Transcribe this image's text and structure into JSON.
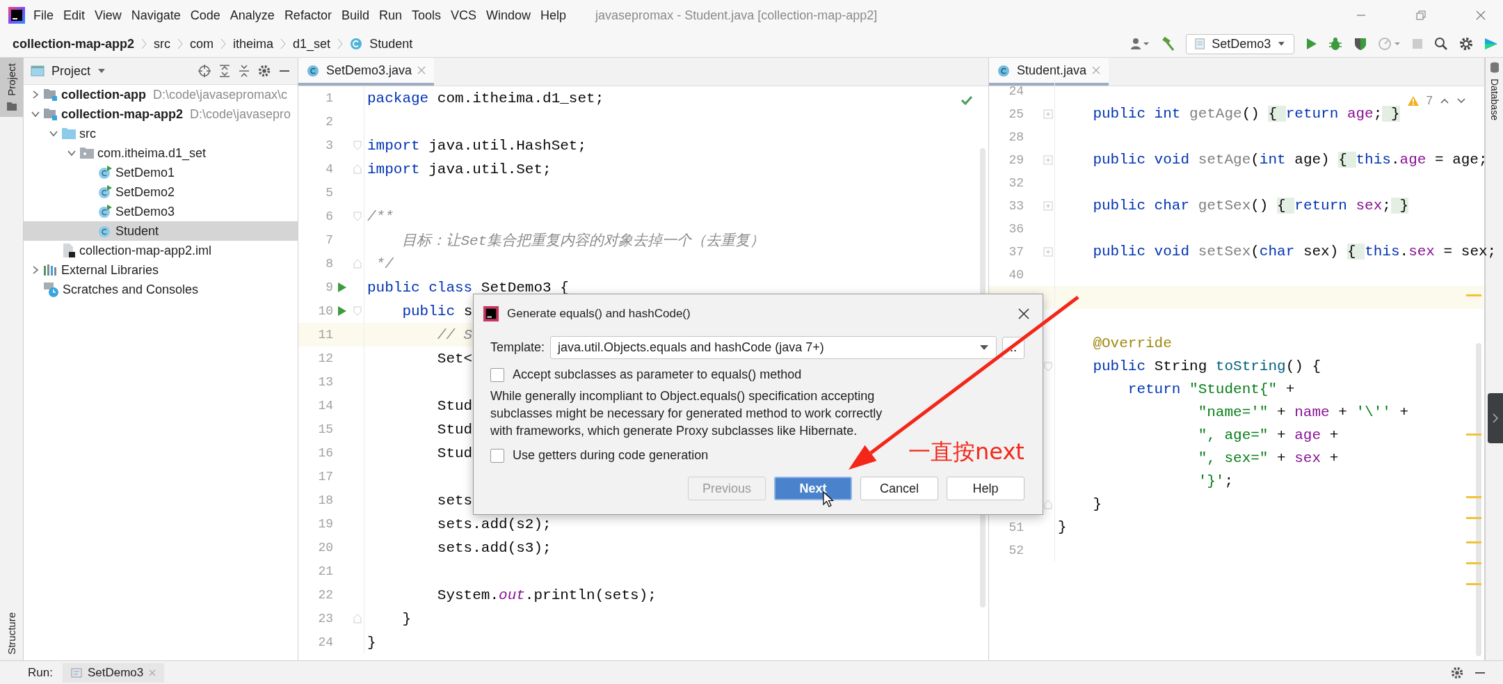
{
  "window": {
    "title": "javasepromax - Student.java [collection-map-app2]"
  },
  "menu": [
    "File",
    "Edit",
    "View",
    "Navigate",
    "Code",
    "Analyze",
    "Refactor",
    "Build",
    "Run",
    "Tools",
    "VCS",
    "Window",
    "Help"
  ],
  "breadcrumb": [
    {
      "label": "collection-map-app2",
      "kind": "project"
    },
    {
      "label": "src",
      "kind": "dir"
    },
    {
      "label": "com",
      "kind": "dir"
    },
    {
      "label": "itheima",
      "kind": "dir"
    },
    {
      "label": "d1_set",
      "kind": "dir"
    },
    {
      "label": "Student",
      "kind": "class"
    }
  ],
  "toolbar": {
    "run_config": "SetDemo3"
  },
  "left_stripe": {
    "top": [
      {
        "label": "Project",
        "selected": true
      }
    ],
    "bottom": [
      {
        "label": "Structure",
        "selected": false
      }
    ]
  },
  "right_stripe": [
    {
      "label": "Database",
      "selected": false
    }
  ],
  "project": {
    "title": "Project",
    "tree": [
      {
        "label": "collection-app",
        "path": "D:\\code\\javasepromax\\c",
        "kind": "module",
        "expanded": false,
        "selected": false
      },
      {
        "label": "collection-map-app2",
        "path": "D:\\code\\javasepro",
        "kind": "module",
        "expanded": true,
        "selected": false,
        "children": [
          {
            "label": "src",
            "kind": "source-folder",
            "expanded": true,
            "selected": false,
            "children": [
              {
                "label": "com.itheima.d1_set",
                "kind": "package",
                "expanded": true,
                "selected": false,
                "children": [
                  {
                    "label": "SetDemo1",
                    "kind": "runnable-class",
                    "selected": false
                  },
                  {
                    "label": "SetDemo2",
                    "kind": "runnable-class",
                    "selected": false
                  },
                  {
                    "label": "SetDemo3",
                    "kind": "runnable-class",
                    "selected": false
                  },
                  {
                    "label": "Student",
                    "kind": "class",
                    "selected": true
                  }
                ]
              }
            ]
          },
          {
            "label": "collection-map-app2.iml",
            "kind": "module-file",
            "selected": false
          }
        ]
      },
      {
        "label": "External Libraries",
        "kind": "libraries",
        "expanded": false,
        "selected": false
      },
      {
        "label": "Scratches and Consoles",
        "kind": "scratches",
        "selected": false
      }
    ]
  },
  "editors": [
    {
      "tabs": [
        {
          "label": "SetDemo3.java",
          "selected": true
        }
      ],
      "lines": [
        {
          "n": "1",
          "run": false,
          "current": false,
          "tokens": [
            {
              "kind": "kw",
              "text": "package"
            },
            {
              "kind": "plain",
              "text": " com.itheima.d1_set;"
            }
          ]
        },
        {
          "n": "2",
          "run": false,
          "current": false
        },
        {
          "n": "3",
          "run": false,
          "current": false,
          "fold": {
            "kind": "start"
          },
          "tokens": [
            {
              "kind": "kw",
              "text": "import"
            },
            {
              "kind": "plain",
              "text": " java.util.HashSet;"
            }
          ]
        },
        {
          "n": "4",
          "run": false,
          "current": false,
          "fold": {
            "kind": "end"
          },
          "tokens": [
            {
              "kind": "kw",
              "text": "import"
            },
            {
              "kind": "plain",
              "text": " java.util.Set;"
            }
          ]
        },
        {
          "n": "5",
          "run": false,
          "current": false
        },
        {
          "n": "6",
          "run": false,
          "current": false,
          "fold": {
            "kind": "start"
          },
          "tokens": [
            {
              "kind": "comment",
              "text": "/**"
            }
          ]
        },
        {
          "n": "7",
          "run": false,
          "current": false,
          "tokens": [
            {
              "kind": "comment",
              "text": "    目标：让Set集合把重复内容的对象去掉一个（去重复）"
            }
          ]
        },
        {
          "n": "8",
          "run": false,
          "current": false,
          "fold": {
            "kind": "end"
          },
          "tokens": [
            {
              "kind": "comment",
              "text": " */"
            }
          ]
        },
        {
          "n": "9",
          "run": true,
          "current": false,
          "tokens": [
            {
              "kind": "kw",
              "text": "public class"
            },
            {
              "kind": "plain",
              "text": " SetDemo3 {"
            }
          ]
        },
        {
          "n": "10",
          "run": true,
          "current": false,
          "fold": {
            "kind": "start"
          },
          "tokens": [
            {
              "kind": "kw",
              "text": "    public"
            },
            {
              "kind": "plain",
              "text": " s"
            }
          ]
        },
        {
          "n": "11",
          "run": false,
          "current": true,
          "tokens": [
            {
              "kind": "comment",
              "text": "        // S"
            }
          ]
        },
        {
          "n": "12",
          "run": false,
          "current": false,
          "tokens": [
            {
              "kind": "plain",
              "text": "        Set<"
            }
          ]
        },
        {
          "n": "13",
          "run": false,
          "current": false
        },
        {
          "n": "14",
          "run": false,
          "current": false,
          "tokens": [
            {
              "kind": "plain",
              "text": "        Stud"
            }
          ]
        },
        {
          "n": "15",
          "run": false,
          "current": false,
          "tokens": [
            {
              "kind": "plain",
              "text": "        Stud"
            }
          ]
        },
        {
          "n": "16",
          "run": false,
          "current": false,
          "tokens": [
            {
              "kind": "plain",
              "text": "        Stud"
            }
          ]
        },
        {
          "n": "17",
          "run": false,
          "current": false
        },
        {
          "n": "18",
          "run": false,
          "current": false,
          "tokens": [
            {
              "kind": "plain",
              "text": "        sets"
            }
          ]
        },
        {
          "n": "19",
          "run": false,
          "current": false,
          "tokens": [
            {
              "kind": "plain",
              "text": "        sets.add(s2);"
            }
          ]
        },
        {
          "n": "20",
          "run": false,
          "current": false,
          "tokens": [
            {
              "kind": "plain",
              "text": "        sets.add(s3);"
            }
          ]
        },
        {
          "n": "21",
          "run": false,
          "current": false
        },
        {
          "n": "22",
          "run": false,
          "current": false,
          "tokens": [
            {
              "kind": "plain",
              "text": "        System."
            },
            {
              "kind": "static",
              "text": "out"
            },
            {
              "kind": "plain",
              "text": ".println(sets);"
            }
          ]
        },
        {
          "n": "23",
          "run": false,
          "current": false,
          "fold": {
            "kind": "end"
          },
          "tokens": [
            {
              "kind": "plain",
              "text": "    }"
            }
          ]
        },
        {
          "n": "24",
          "run": false,
          "current": false,
          "tokens": [
            {
              "kind": "plain",
              "text": "}"
            }
          ]
        }
      ]
    },
    {
      "tabs": [
        {
          "label": "Student.java",
          "selected": true
        }
      ],
      "warnings": "7",
      "lines": [
        {
          "n": "24",
          "current": false
        },
        {
          "n": "25",
          "current": false,
          "fold": {
            "kind": "collapsed"
          },
          "tokens": [
            {
              "kind": "kw",
              "text": "    public int"
            },
            {
              "kind": "unused",
              "text": " getAge"
            },
            {
              "kind": "plain",
              "text": "() "
            },
            {
              "kind": "fold-brace",
              "text": "{ "
            },
            {
              "kind": "kw",
              "text": "return"
            },
            {
              "kind": "field",
              "text": " age"
            },
            {
              "kind": "plain",
              "text": ";"
            },
            {
              "kind": "fold-brace",
              "text": " }"
            }
          ]
        },
        {
          "n": "28",
          "current": false
        },
        {
          "n": "29",
          "current": false,
          "fold": {
            "kind": "collapsed"
          },
          "tokens": [
            {
              "kind": "kw",
              "text": "    public void"
            },
            {
              "kind": "unused",
              "text": " setAge"
            },
            {
              "kind": "plain",
              "text": "("
            },
            {
              "kind": "kw",
              "text": "int"
            },
            {
              "kind": "plain",
              "text": " age) "
            },
            {
              "kind": "fold-brace",
              "text": "{ "
            },
            {
              "kind": "kw",
              "text": "this"
            },
            {
              "kind": "plain",
              "text": "."
            },
            {
              "kind": "field",
              "text": "age"
            },
            {
              "kind": "plain",
              "text": " = age;"
            }
          ]
        },
        {
          "n": "32",
          "current": false
        },
        {
          "n": "33",
          "current": false,
          "fold": {
            "kind": "collapsed"
          },
          "tokens": [
            {
              "kind": "kw",
              "text": "    public char"
            },
            {
              "kind": "unused",
              "text": " getSex"
            },
            {
              "kind": "plain",
              "text": "() "
            },
            {
              "kind": "fold-brace",
              "text": "{ "
            },
            {
              "kind": "kw",
              "text": "return"
            },
            {
              "kind": "field",
              "text": " sex"
            },
            {
              "kind": "plain",
              "text": ";"
            },
            {
              "kind": "fold-brace",
              "text": " }"
            }
          ]
        },
        {
          "n": "36",
          "current": false
        },
        {
          "n": "37",
          "current": false,
          "fold": {
            "kind": "collapsed"
          },
          "tokens": [
            {
              "kind": "kw",
              "text": "    public void"
            },
            {
              "kind": "unused",
              "text": " setSex"
            },
            {
              "kind": "plain",
              "text": "("
            },
            {
              "kind": "kw",
              "text": "char"
            },
            {
              "kind": "plain",
              "text": " sex) "
            },
            {
              "kind": "fold-brace",
              "text": "{ "
            },
            {
              "kind": "kw",
              "text": "this"
            },
            {
              "kind": "plain",
              "text": "."
            },
            {
              "kind": "field",
              "text": "sex"
            },
            {
              "kind": "plain",
              "text": " = sex;"
            }
          ]
        },
        {
          "n": "40",
          "current": false
        },
        {
          "current": true
        },
        {
          "current": false
        },
        {
          "current": false,
          "tokens": [
            {
              "kind": "annotation",
              "text": "    @Override"
            }
          ]
        },
        {
          "current": false,
          "fold": {
            "kind": "start"
          },
          "tokens": [
            {
              "kind": "kw",
              "text": "    public"
            },
            {
              "kind": "plain",
              "text": " String "
            },
            {
              "kind": "method",
              "text": "toString"
            },
            {
              "kind": "plain",
              "text": "() {"
            }
          ]
        },
        {
          "current": false,
          "tokens": [
            {
              "kind": "kw",
              "text": "        return"
            },
            {
              "kind": "str",
              "text": " \"Student{\""
            },
            {
              "kind": "plain",
              "text": " +"
            }
          ]
        },
        {
          "current": false,
          "tokens": [
            {
              "kind": "str",
              "text": "                \"name='\""
            },
            {
              "kind": "plain",
              "text": " + "
            },
            {
              "kind": "field",
              "text": "name"
            },
            {
              "kind": "plain",
              "text": " + "
            },
            {
              "kind": "str",
              "text": "'\\''"
            },
            {
              "kind": "plain",
              "text": " +"
            }
          ]
        },
        {
          "current": false,
          "tokens": [
            {
              "kind": "str",
              "text": "                \", age=\""
            },
            {
              "kind": "plain",
              "text": " + "
            },
            {
              "kind": "field",
              "text": "age"
            },
            {
              "kind": "plain",
              "text": " +"
            }
          ]
        },
        {
          "current": false,
          "tokens": [
            {
              "kind": "str",
              "text": "                \", sex=\""
            },
            {
              "kind": "plain",
              "text": " + "
            },
            {
              "kind": "field",
              "text": "sex"
            },
            {
              "kind": "plain",
              "text": " +"
            }
          ]
        },
        {
          "current": false,
          "tokens": [
            {
              "kind": "str",
              "text": "                '}'"
            },
            {
              "kind": "plain",
              "text": ";"
            }
          ]
        },
        {
          "current": false,
          "fold": {
            "kind": "end"
          },
          "tokens": [
            {
              "kind": "plain",
              "text": "    }"
            }
          ]
        },
        {
          "n": "51",
          "current": false,
          "tokens": [
            {
              "kind": "plain",
              "text": "}"
            }
          ]
        },
        {
          "n": "52",
          "current": false
        }
      ]
    }
  ],
  "dialog": {
    "title": "Generate equals() and hashCode()",
    "template_label": "Template:",
    "template_value": "java.util.Objects.equals and hashCode (java 7+)",
    "browse_button": "..",
    "options": [
      {
        "label": "Accept subclasses as parameter to equals() method",
        "checked": false
      },
      {
        "label": "Use getters during code generation",
        "checked": false
      }
    ],
    "description": "While generally incompliant to Object.equals() specification accepting subclasses might be necessary for generated method to work correctly with frameworks, which generate Proxy subclasses like Hibernate.",
    "buttons": [
      {
        "label": "Previous",
        "disabled": true,
        "default": false
      },
      {
        "label": "Next",
        "disabled": false,
        "default": true
      },
      {
        "label": "Cancel",
        "disabled": false,
        "default": false
      },
      {
        "label": "Help",
        "disabled": false,
        "default": false
      }
    ]
  },
  "annotation": {
    "text": "一直按next"
  },
  "run_bar": {
    "label": "Run:",
    "tabs": [
      {
        "label": "SetDemo3",
        "selected": true
      }
    ]
  }
}
